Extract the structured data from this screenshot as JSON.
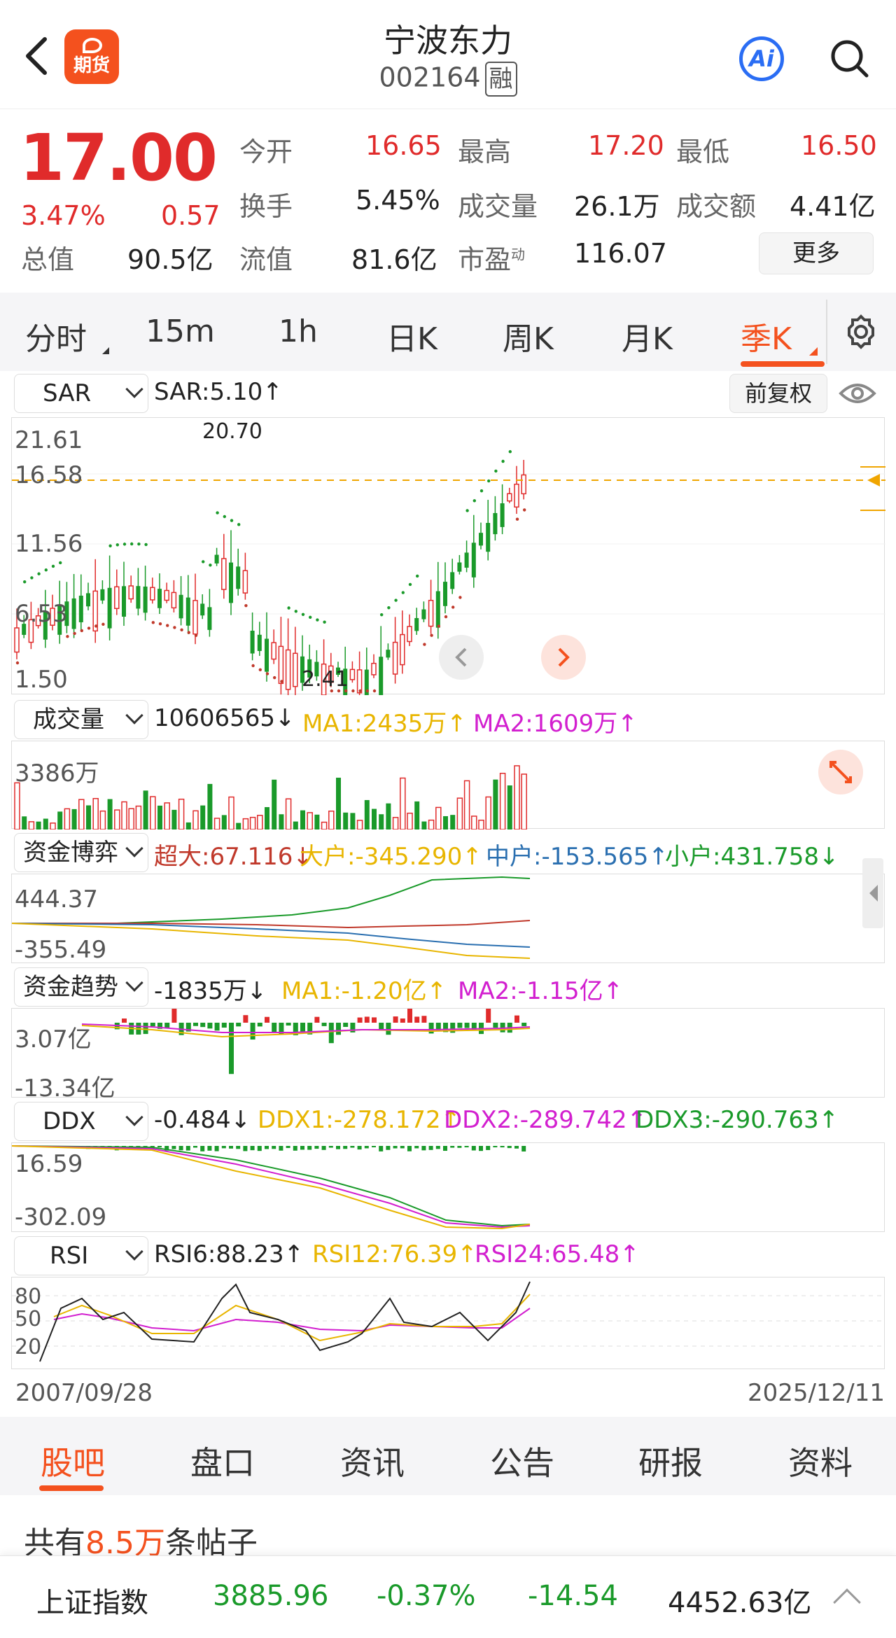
{
  "header": {
    "stock_name": "宁波东力",
    "stock_code": "002164",
    "margin_badge": "融",
    "futures_label": "期货",
    "ai_label": "Ai"
  },
  "quote": {
    "price": "17.00",
    "change_pct": "3.47%",
    "change_amt": "0.57",
    "total_value_label": "总值",
    "total_value": "90.5亿",
    "float_value_label": "流值",
    "float_value": "81.6亿",
    "open_label": "今开",
    "open": "16.65",
    "high_label": "最高",
    "high": "17.20",
    "low_label": "最低",
    "low": "16.50",
    "turnover_label": "换手",
    "turnover": "5.45%",
    "volume_label": "成交量",
    "volume": "26.1万",
    "amount_label": "成交额",
    "amount": "4.41亿",
    "pe_label": "市盈",
    "pe_sup": "动",
    "pe": "116.07",
    "more_label": "更多"
  },
  "period_tabs": [
    "分时",
    "15m",
    "1h",
    "日K",
    "周K",
    "月K",
    "季K"
  ],
  "active_period": "季K",
  "sar_panel": {
    "selector": "SAR",
    "value": "SAR:5.10↑",
    "adjust_button": "前复权",
    "y_labels": [
      "21.61",
      "16.58",
      "11.56",
      "6.53",
      "1.50"
    ],
    "high_mark": "20.70",
    "low_mark": "2.41"
  },
  "volume_panel": {
    "selector": "成交量",
    "value": "10606565↓",
    "ma1": "MA1:2435万↑",
    "ma2": "MA2:1609万↑",
    "y_label": "3386万"
  },
  "fund_game_panel": {
    "selector": "资金博弈",
    "super": "超大:67.116↓",
    "large": "大户:-345.290↑",
    "medium": "中户:-153.565↑",
    "small": "小户:431.758↓",
    "y_top": "444.37",
    "y_bottom": "-355.49"
  },
  "fund_trend_panel": {
    "selector": "资金趋势",
    "value": "-1835万↓",
    "ma1": "MA1:-1.20亿↑",
    "ma2": "MA2:-1.15亿↑",
    "y_top": "3.07亿",
    "y_bottom": "-13.34亿"
  },
  "ddx_panel": {
    "selector": "DDX",
    "value": "-0.484↓",
    "ddx1": "DDX1:-278.172↑",
    "ddx2": "DDX2:-289.742↑",
    "ddx3": "DDX3:-290.763↑",
    "y_top": "16.59",
    "y_bottom": "-302.09"
  },
  "rsi_panel": {
    "selector": "RSI",
    "rsi6": "RSI6:88.23↑",
    "rsi12": "RSI12:76.39↑",
    "rsi24": "RSI24:65.48↑",
    "y_labels": [
      "80",
      "50",
      "20"
    ]
  },
  "date_range": {
    "start": "2007/09/28",
    "end": "2025/12/11"
  },
  "bottom_tabs": [
    "股吧",
    "盘口",
    "资讯",
    "公告",
    "研报",
    "资料"
  ],
  "active_bottom_tab": "股吧",
  "posts": {
    "prefix": "共有",
    "count": "8.5万",
    "suffix": "条帖子"
  },
  "index_bar": {
    "name": "上证指数",
    "value": "3885.96",
    "change_pct": "-0.37%",
    "change": "-14.54",
    "amount": "4452.63亿"
  },
  "colors": {
    "up": "#e02b2b",
    "down": "#1a9a2a",
    "accent": "#f4511e",
    "ma1": "#e8b500",
    "ma2": "#d21fcf",
    "medium": "#2a6fb0"
  }
}
